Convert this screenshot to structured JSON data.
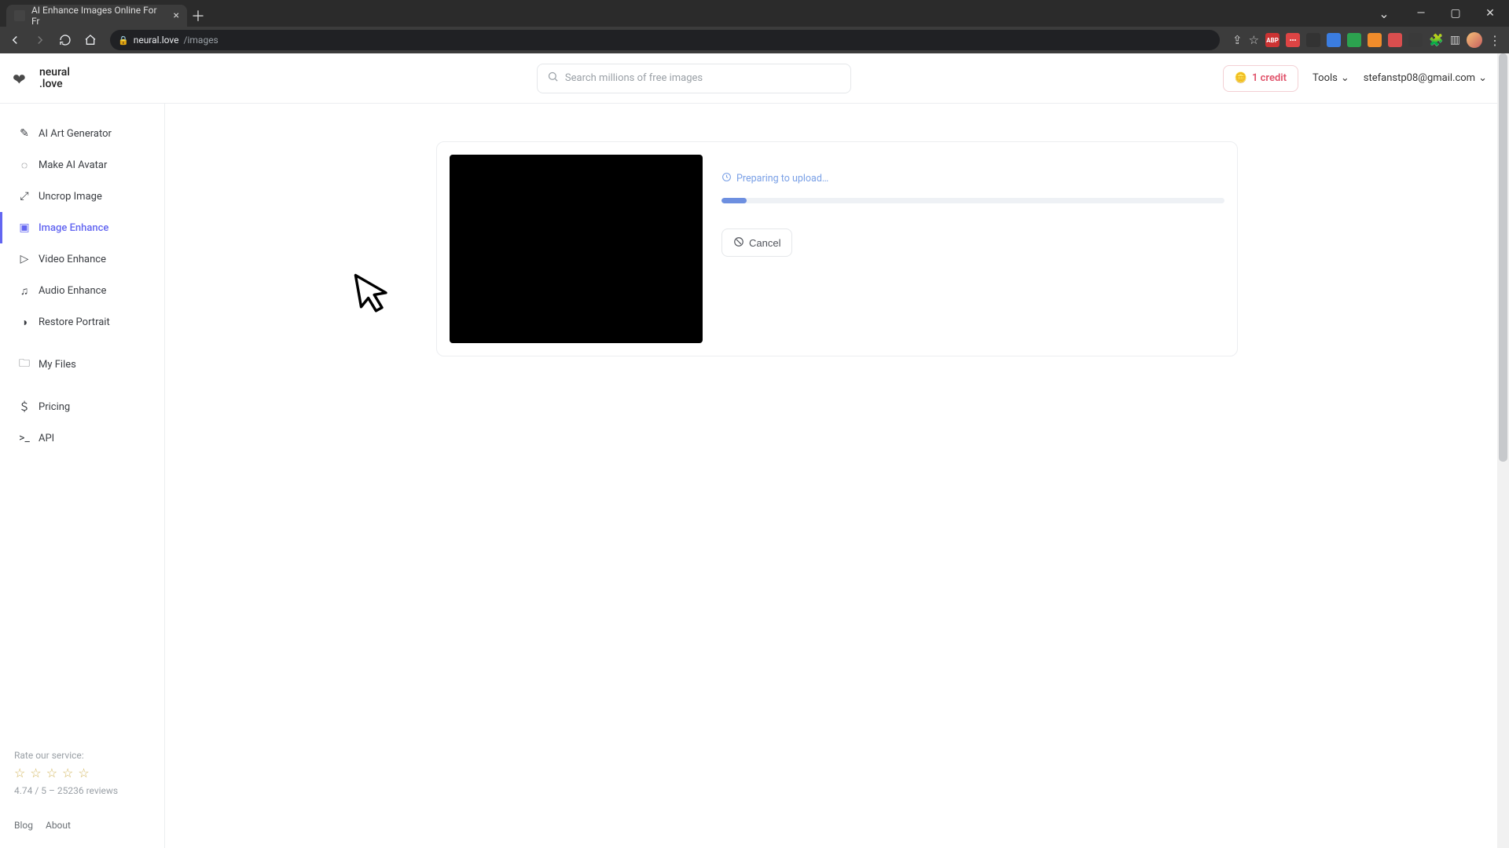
{
  "browser": {
    "tab_title": "AI Enhance Images Online For Fr",
    "url_domain": "neural.love",
    "url_path": "/images"
  },
  "header": {
    "logo_line1": "neural",
    "logo_line2": ".love",
    "search_placeholder": "Search millions of free images",
    "credits_label": "1 credit",
    "tools_label": "Tools",
    "user_email": "stefanstp08@gmail.com"
  },
  "sidebar": {
    "items": [
      {
        "label": "AI Art Generator"
      },
      {
        "label": "Make AI Avatar"
      },
      {
        "label": "Uncrop Image"
      },
      {
        "label": "Image Enhance"
      },
      {
        "label": "Video Enhance"
      },
      {
        "label": "Audio Enhance"
      },
      {
        "label": "Restore Portrait"
      }
    ],
    "files_label": "My Files",
    "pricing_label": "Pricing",
    "api_label": "API",
    "active_index": 3,
    "rate_prompt": "Rate our service:",
    "rating_text": "4.74 / 5 – 25236 reviews",
    "blog_label": "Blog",
    "about_label": "About"
  },
  "upload": {
    "status_text": "Preparing to upload…",
    "cancel_label": "Cancel",
    "progress_percent": 5
  }
}
